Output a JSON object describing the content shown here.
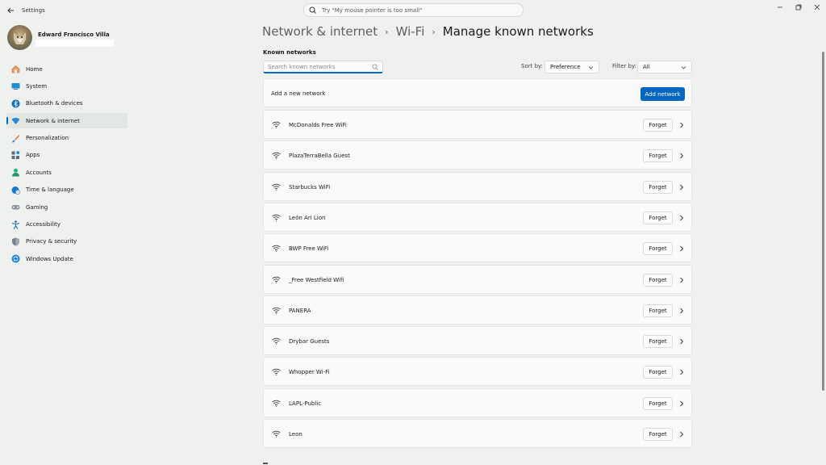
{
  "window": {
    "title": "Settings",
    "search_placeholder": "Try \"My mouse pointer is too small\""
  },
  "user": {
    "name": "Edward Francisco Villa"
  },
  "sidebar": {
    "items": [
      {
        "label": "Home",
        "icon": "home-icon",
        "color": "#e0864a"
      },
      {
        "label": "System",
        "icon": "system-icon",
        "color": "#0a84c9"
      },
      {
        "label": "Bluetooth & devices",
        "icon": "bluetooth-icon",
        "color": "#0a6fc2"
      },
      {
        "label": "Network & internet",
        "icon": "wifi-icon",
        "color": "#2a8ad8"
      },
      {
        "label": "Personalization",
        "icon": "brush-icon",
        "color": "#e07a3a"
      },
      {
        "label": "Apps",
        "icon": "apps-icon",
        "color": "#5a6a7a"
      },
      {
        "label": "Accounts",
        "icon": "person-icon",
        "color": "#2bb57a"
      },
      {
        "label": "Time & language",
        "icon": "globe-clock-icon",
        "color": "#1a7ac8"
      },
      {
        "label": "Gaming",
        "icon": "gamepad-icon",
        "color": "#7a8a9a"
      },
      {
        "label": "Accessibility",
        "icon": "accessibility-icon",
        "color": "#1a6fc0"
      },
      {
        "label": "Privacy & security",
        "icon": "shield-icon",
        "color": "#7a8290"
      },
      {
        "label": "Windows Update",
        "icon": "update-icon",
        "color": "#1a84d8"
      }
    ],
    "active_index": 3
  },
  "breadcrumb": {
    "items": [
      "Network & internet",
      "Wi-Fi",
      "Manage known networks"
    ]
  },
  "main": {
    "section_label": "Known networks",
    "search_placeholder": "Search known networks",
    "sort_label": "Sort by:",
    "sort_value": "Preference",
    "filter_label": "Filter by:",
    "filter_value": "All",
    "add_network_label": "Add a new network",
    "add_network_button": "Add network",
    "forget_label": "Forget",
    "networks": [
      "McDonalds Free WiFi",
      "PlazaTerraBella Guest",
      "Starbucks WiFi",
      "León Ari Lion",
      "BWP Free WiFi",
      "_Free Westfield Wifi",
      "PANERA",
      "Drybar Guests",
      "Whopper Wi-Fi",
      "LAPL-Public",
      "Leon"
    ]
  },
  "colors": {
    "accent": "#0067c0",
    "background": "#eef1ee",
    "card": "#f9faf9"
  }
}
